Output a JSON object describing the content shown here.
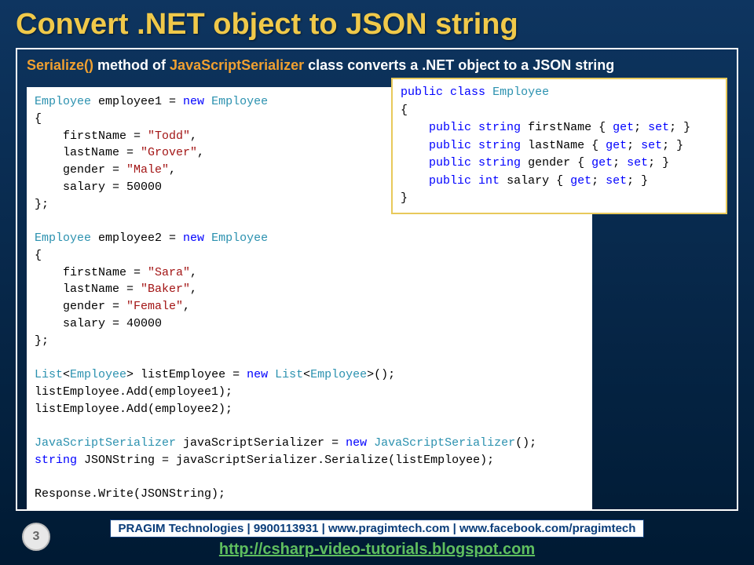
{
  "title": "Convert .NET object to JSON string",
  "subtitle": {
    "seg1": "Serialize()",
    "seg2": " method of ",
    "seg3": "JavaScriptSerializer",
    "seg4": " class converts a .NET object to a JSON string"
  },
  "code_main": {
    "l01a": "Employee",
    "l01b": " employee1 = ",
    "l01c": "new",
    "l01d": " ",
    "l01e": "Employee",
    "l02": "{",
    "l03a": "    firstName = ",
    "l03b": "\"Todd\"",
    "l03c": ",",
    "l04a": "    lastName = ",
    "l04b": "\"Grover\"",
    "l04c": ",",
    "l05a": "    gender = ",
    "l05b": "\"Male\"",
    "l05c": ",",
    "l06": "    salary = 50000",
    "l07": "};",
    "l08": "",
    "l09a": "Employee",
    "l09b": " employee2 = ",
    "l09c": "new",
    "l09d": " ",
    "l09e": "Employee",
    "l10": "{",
    "l11a": "    firstName = ",
    "l11b": "\"Sara\"",
    "l11c": ",",
    "l12a": "    lastName = ",
    "l12b": "\"Baker\"",
    "l12c": ",",
    "l13a": "    gender = ",
    "l13b": "\"Female\"",
    "l13c": ",",
    "l14": "    salary = 40000",
    "l15": "};",
    "l16": "",
    "l17a": "List",
    "l17b": "<",
    "l17c": "Employee",
    "l17d": "> listEmployee = ",
    "l17e": "new",
    "l17f": " ",
    "l17g": "List",
    "l17h": "<",
    "l17i": "Employee",
    "l17j": ">();",
    "l18": "listEmployee.Add(employee1);",
    "l19": "listEmployee.Add(employee2);",
    "l20": "",
    "l21a": "JavaScriptSerializer",
    "l21b": " javaScriptSerializer = ",
    "l21c": "new",
    "l21d": " ",
    "l21e": "JavaScriptSerializer",
    "l21f": "();",
    "l22a": "string",
    "l22b": " JSONString = javaScriptSerializer.Serialize(listEmployee);",
    "l23": "",
    "l24": "Response.Write(JSONString);"
  },
  "code_class": {
    "c01a": "public",
    "c01b": " ",
    "c01c": "class",
    "c01d": " ",
    "c01e": "Employee",
    "c02": "{",
    "c03a": "    ",
    "c03b": "public",
    "c03c": " ",
    "c03d": "string",
    "c03e": " firstName { ",
    "c03f": "get",
    "c03g": "; ",
    "c03h": "set",
    "c03i": "; }",
    "c04a": "    ",
    "c04b": "public",
    "c04c": " ",
    "c04d": "string",
    "c04e": " lastName { ",
    "c04f": "get",
    "c04g": "; ",
    "c04h": "set",
    "c04i": "; }",
    "c05a": "    ",
    "c05b": "public",
    "c05c": " ",
    "c05d": "string",
    "c05e": " gender { ",
    "c05f": "get",
    "c05g": "; ",
    "c05h": "set",
    "c05i": "; }",
    "c06a": "    ",
    "c06b": "public",
    "c06c": " ",
    "c06d": "int",
    "c06e": " salary { ",
    "c06f": "get",
    "c06g": "; ",
    "c06h": "set",
    "c06i": "; }",
    "c07": "}"
  },
  "footer": {
    "bar": "PRAGIM Technologies | 9900113931 | www.pragimtech.com | www.facebook.com/pragimtech",
    "link": "http://csharp-video-tutorials.blogspot.com"
  },
  "page_number": "3"
}
